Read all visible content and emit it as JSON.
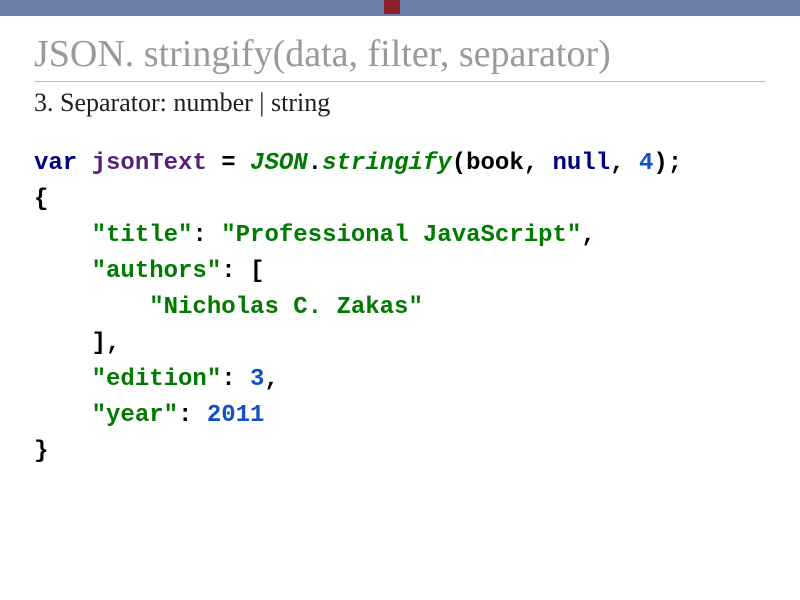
{
  "title": "JSON. stringify(data, filter, separator)",
  "subtitle": "3. Separator: number | string",
  "code": {
    "kw_var": "var",
    "var_name": "jsonText",
    "eq": " = ",
    "cls": "JSON",
    "dot": ".",
    "method": "stringify",
    "open_paren": "(",
    "arg1": "book",
    "comma1": ", ",
    "arg2": "null",
    "comma2": ", ",
    "arg3": "4",
    "close_call": ");",
    "open_brace": "{",
    "indent1": "    ",
    "indent2": "        ",
    "k_title": "\"title\"",
    "colon": ": ",
    "v_title": "\"Professional JavaScript\"",
    "comma": ",",
    "k_authors": "\"authors\"",
    "arr_open": "[",
    "v_author": "\"Nicholas C. Zakas\"",
    "arr_close": "]",
    "k_edition": "\"edition\"",
    "v_edition": "3",
    "k_year": "\"year\"",
    "v_year": "2011",
    "close_brace": "}"
  }
}
